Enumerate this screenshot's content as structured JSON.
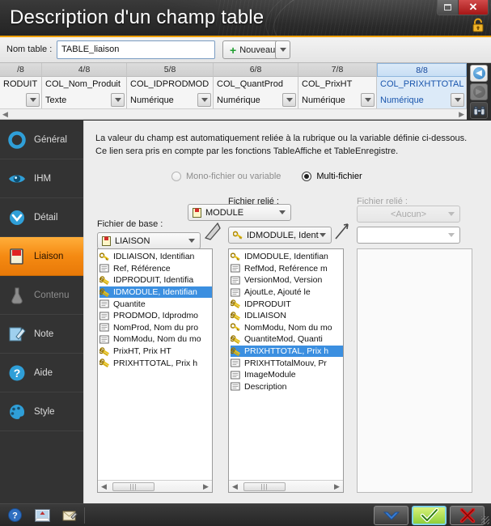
{
  "window": {
    "title": "Description d'un champ table",
    "lock_icon": "padlock-icon",
    "restore_label": "",
    "close_label": "✕"
  },
  "namerow": {
    "label": "Nom table :",
    "table_name": "TABLE_liaison",
    "new_button": "Nouveau",
    "new_button_accesskey": "N"
  },
  "columns": {
    "headers": [
      "/8",
      "4/8",
      "5/8",
      "6/8",
      "7/8",
      "8/8"
    ],
    "names": [
      "RODUIT",
      "COL_Nom_Produit",
      "COL_IDPRODMOD",
      "COL_QuantProd",
      "COL_PrixHT",
      "COL_PRIXHTTOTAL"
    ],
    "types": [
      "",
      "Texte",
      "Numérique",
      "Numérique",
      "Numérique",
      "Numérique"
    ],
    "selected_index": 5,
    "scroll_left": "◀",
    "scroll_right": "▶"
  },
  "vtools": [
    {
      "name": "back-button",
      "glyph": "◀",
      "enabled": true
    },
    {
      "name": "forward-button",
      "glyph": "▶",
      "enabled": false
    },
    {
      "name": "binoculars-button",
      "glyph": "",
      "enabled": true
    }
  ],
  "sidebar": {
    "items": [
      {
        "label": "Général",
        "icon": "circle-ring-icon",
        "state": "normal"
      },
      {
        "label": "IHM",
        "icon": "eye-icon",
        "state": "normal"
      },
      {
        "label": "Détail",
        "icon": "circle-chevron-icon",
        "state": "normal"
      },
      {
        "label": "Liaison",
        "icon": "page-red-icon",
        "state": "active"
      },
      {
        "label": "Contenu",
        "icon": "flask-icon",
        "state": "disabled"
      },
      {
        "label": "Note",
        "icon": "pencil-note-icon",
        "state": "normal"
      },
      {
        "label": "Aide",
        "icon": "question-circle-icon",
        "state": "normal"
      },
      {
        "label": "Style",
        "icon": "palette-icon",
        "state": "normal"
      }
    ]
  },
  "main": {
    "description_line1": "La valeur du champ est automatiquement reliée à la rubrique ou la variable définie ci-dessous.",
    "description_line2": "Ce lien sera pris en compte par les fonctions TableAffiche et TableEnregistre.",
    "radio_mono": "Mono-fichier ou variable",
    "radio_multi": "Multi-fichier",
    "radio_selected": "multi",
    "label_fichier_base": "Fichier de base :",
    "label_fichier_relie_1": "Fichier relié :",
    "label_fichier_relie_2": "Fichier relié :",
    "dd_base_value": "LIAISON",
    "dd_mid_value": "IDMODULE, Ident",
    "dd_right_value": "<Aucun>",
    "dd_right2_value": ""
  },
  "list_left": {
    "items": [
      {
        "text": "IDLIAISON, Identifian",
        "icon": "key-icon",
        "selected": false
      },
      {
        "text": "Ref, Référence",
        "icon": "page-icon",
        "selected": false
      },
      {
        "text": "IDPRODUIT, Identifia",
        "icon": "key-double-icon",
        "selected": false
      },
      {
        "text": "IDMODULE, Identifian",
        "icon": "key-double-icon",
        "selected": true
      },
      {
        "text": "Quantite",
        "icon": "page-icon",
        "selected": false
      },
      {
        "text": "PRODMOD, Idprodmo",
        "icon": "page-icon",
        "selected": false
      },
      {
        "text": "NomProd, Nom du pro",
        "icon": "page-icon",
        "selected": false
      },
      {
        "text": "NomModu, Nom du mo",
        "icon": "page-icon",
        "selected": false
      },
      {
        "text": "PrixHT, Prix HT",
        "icon": "key-double-icon",
        "selected": false
      },
      {
        "text": "PRIXHTTOTAL, Prix h",
        "icon": "key-double-icon",
        "selected": false
      }
    ],
    "scroll_left": "◀",
    "scroll_right": "▶"
  },
  "list_mid": {
    "items": [
      {
        "text": "IDMODULE, Identifian",
        "icon": "key-icon",
        "selected": false
      },
      {
        "text": "RefMod, Reférence m",
        "icon": "page-icon",
        "selected": false
      },
      {
        "text": "VersionMod, Version",
        "icon": "page-icon",
        "selected": false
      },
      {
        "text": "AjoutLe, Ajouté le",
        "icon": "page-icon",
        "selected": false
      },
      {
        "text": "IDPRODUIT",
        "icon": "key-double-icon",
        "selected": false
      },
      {
        "text": "IDLIAISON",
        "icon": "key-double-icon",
        "selected": false
      },
      {
        "text": "NomModu, Nom du mo",
        "icon": "key-icon",
        "selected": false
      },
      {
        "text": "QuantiteMod, Quanti",
        "icon": "key-double-icon",
        "selected": false
      },
      {
        "text": "PRIXHTTOTAL, Prix h",
        "icon": "key-double-icon",
        "selected": true
      },
      {
        "text": "PRIXHTTotalMouv, Pr",
        "icon": "page-icon",
        "selected": false
      },
      {
        "text": "ImageModule",
        "icon": "page-icon",
        "selected": false
      },
      {
        "text": "Description",
        "icon": "page-icon",
        "selected": false
      }
    ],
    "scroll_left": "◀",
    "scroll_right": "▶"
  },
  "list_right": {
    "items": []
  },
  "statusbar": {
    "left_icons": [
      {
        "name": "help-icon",
        "glyph": "?"
      },
      {
        "name": "image-insert-icon",
        "glyph": ""
      },
      {
        "name": "note-edit-icon",
        "glyph": ""
      }
    ],
    "dropdown_button": "▼",
    "ok_button": "✓",
    "cancel_button": "✗"
  },
  "colors": {
    "accent_orange": "#f58a12",
    "title_underline": "#f0a000",
    "selection_blue": "#3b8fe0",
    "header_sel_blue": "#dceaf8",
    "ok_green": "#8fcf3a",
    "cancel_red": "#cc2222"
  }
}
